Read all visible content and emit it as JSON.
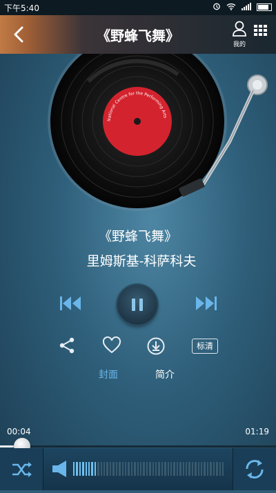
{
  "status_bar": {
    "time": "下午5:40"
  },
  "header": {
    "title": "《野蜂飞舞》",
    "mine_label": "我的"
  },
  "record": {
    "label_text_top": "NATIONAL",
    "label_text_side": "National Centre for the Performing Arts"
  },
  "song": {
    "title": "《野蜂飞舞》",
    "artist": "里姆斯基-科萨科夫"
  },
  "actions": {
    "quality_label": "标清"
  },
  "tabs": [
    {
      "label": "封面",
      "active": true
    },
    {
      "label": "简介",
      "active": false
    }
  ],
  "progress": {
    "elapsed": "00:04",
    "total": "01:19",
    "fraction": 0.05
  },
  "volume": {
    "level": 0.16,
    "segments": 50
  },
  "colors": {
    "accent": "#6ab6ea",
    "header_left": "#c07a45"
  }
}
